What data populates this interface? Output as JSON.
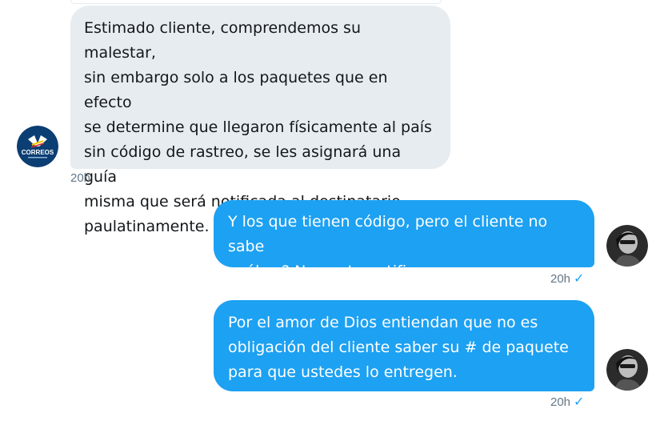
{
  "messages": [
    {
      "direction": "received",
      "text": "Estimado cliente, comprendemos su malestar,\nsin embargo solo a los paquetes que en efecto\nse determine que llegaron físicamente al país\nsin código de rastreo, se les asignará una guía\nmisma que será notificada al destinatario\npaulatinamente.",
      "time": "20h",
      "avatar": {
        "icon": "correos-logo-icon",
        "label": "CORREOS"
      }
    },
    {
      "direction": "sent",
      "text": "Y los que tienen código, pero el cliente no sabe\ncuál es? Nunca te notifican.",
      "time": "20h",
      "status_icon": "check-icon",
      "status_glyph": "✓",
      "avatar": {
        "icon": "user-avatar-icon"
      }
    },
    {
      "direction": "sent",
      "text": "Por el amor de Dios entiendan que no es\nobligación del cliente saber su # de paquete\npara que ustedes lo entregen.",
      "time": "20h",
      "status_icon": "check-icon",
      "status_glyph": "✓",
      "avatar": {
        "icon": "user-avatar-icon"
      }
    }
  ],
  "colors": {
    "received_bubble": "#e6ecf0",
    "sent_bubble": "#1da1f2",
    "received_text": "#14171a",
    "sent_text": "#ffffff",
    "timestamp": "#657786",
    "check": "#1da1f2",
    "correos_blue": "#0b3e73"
  }
}
